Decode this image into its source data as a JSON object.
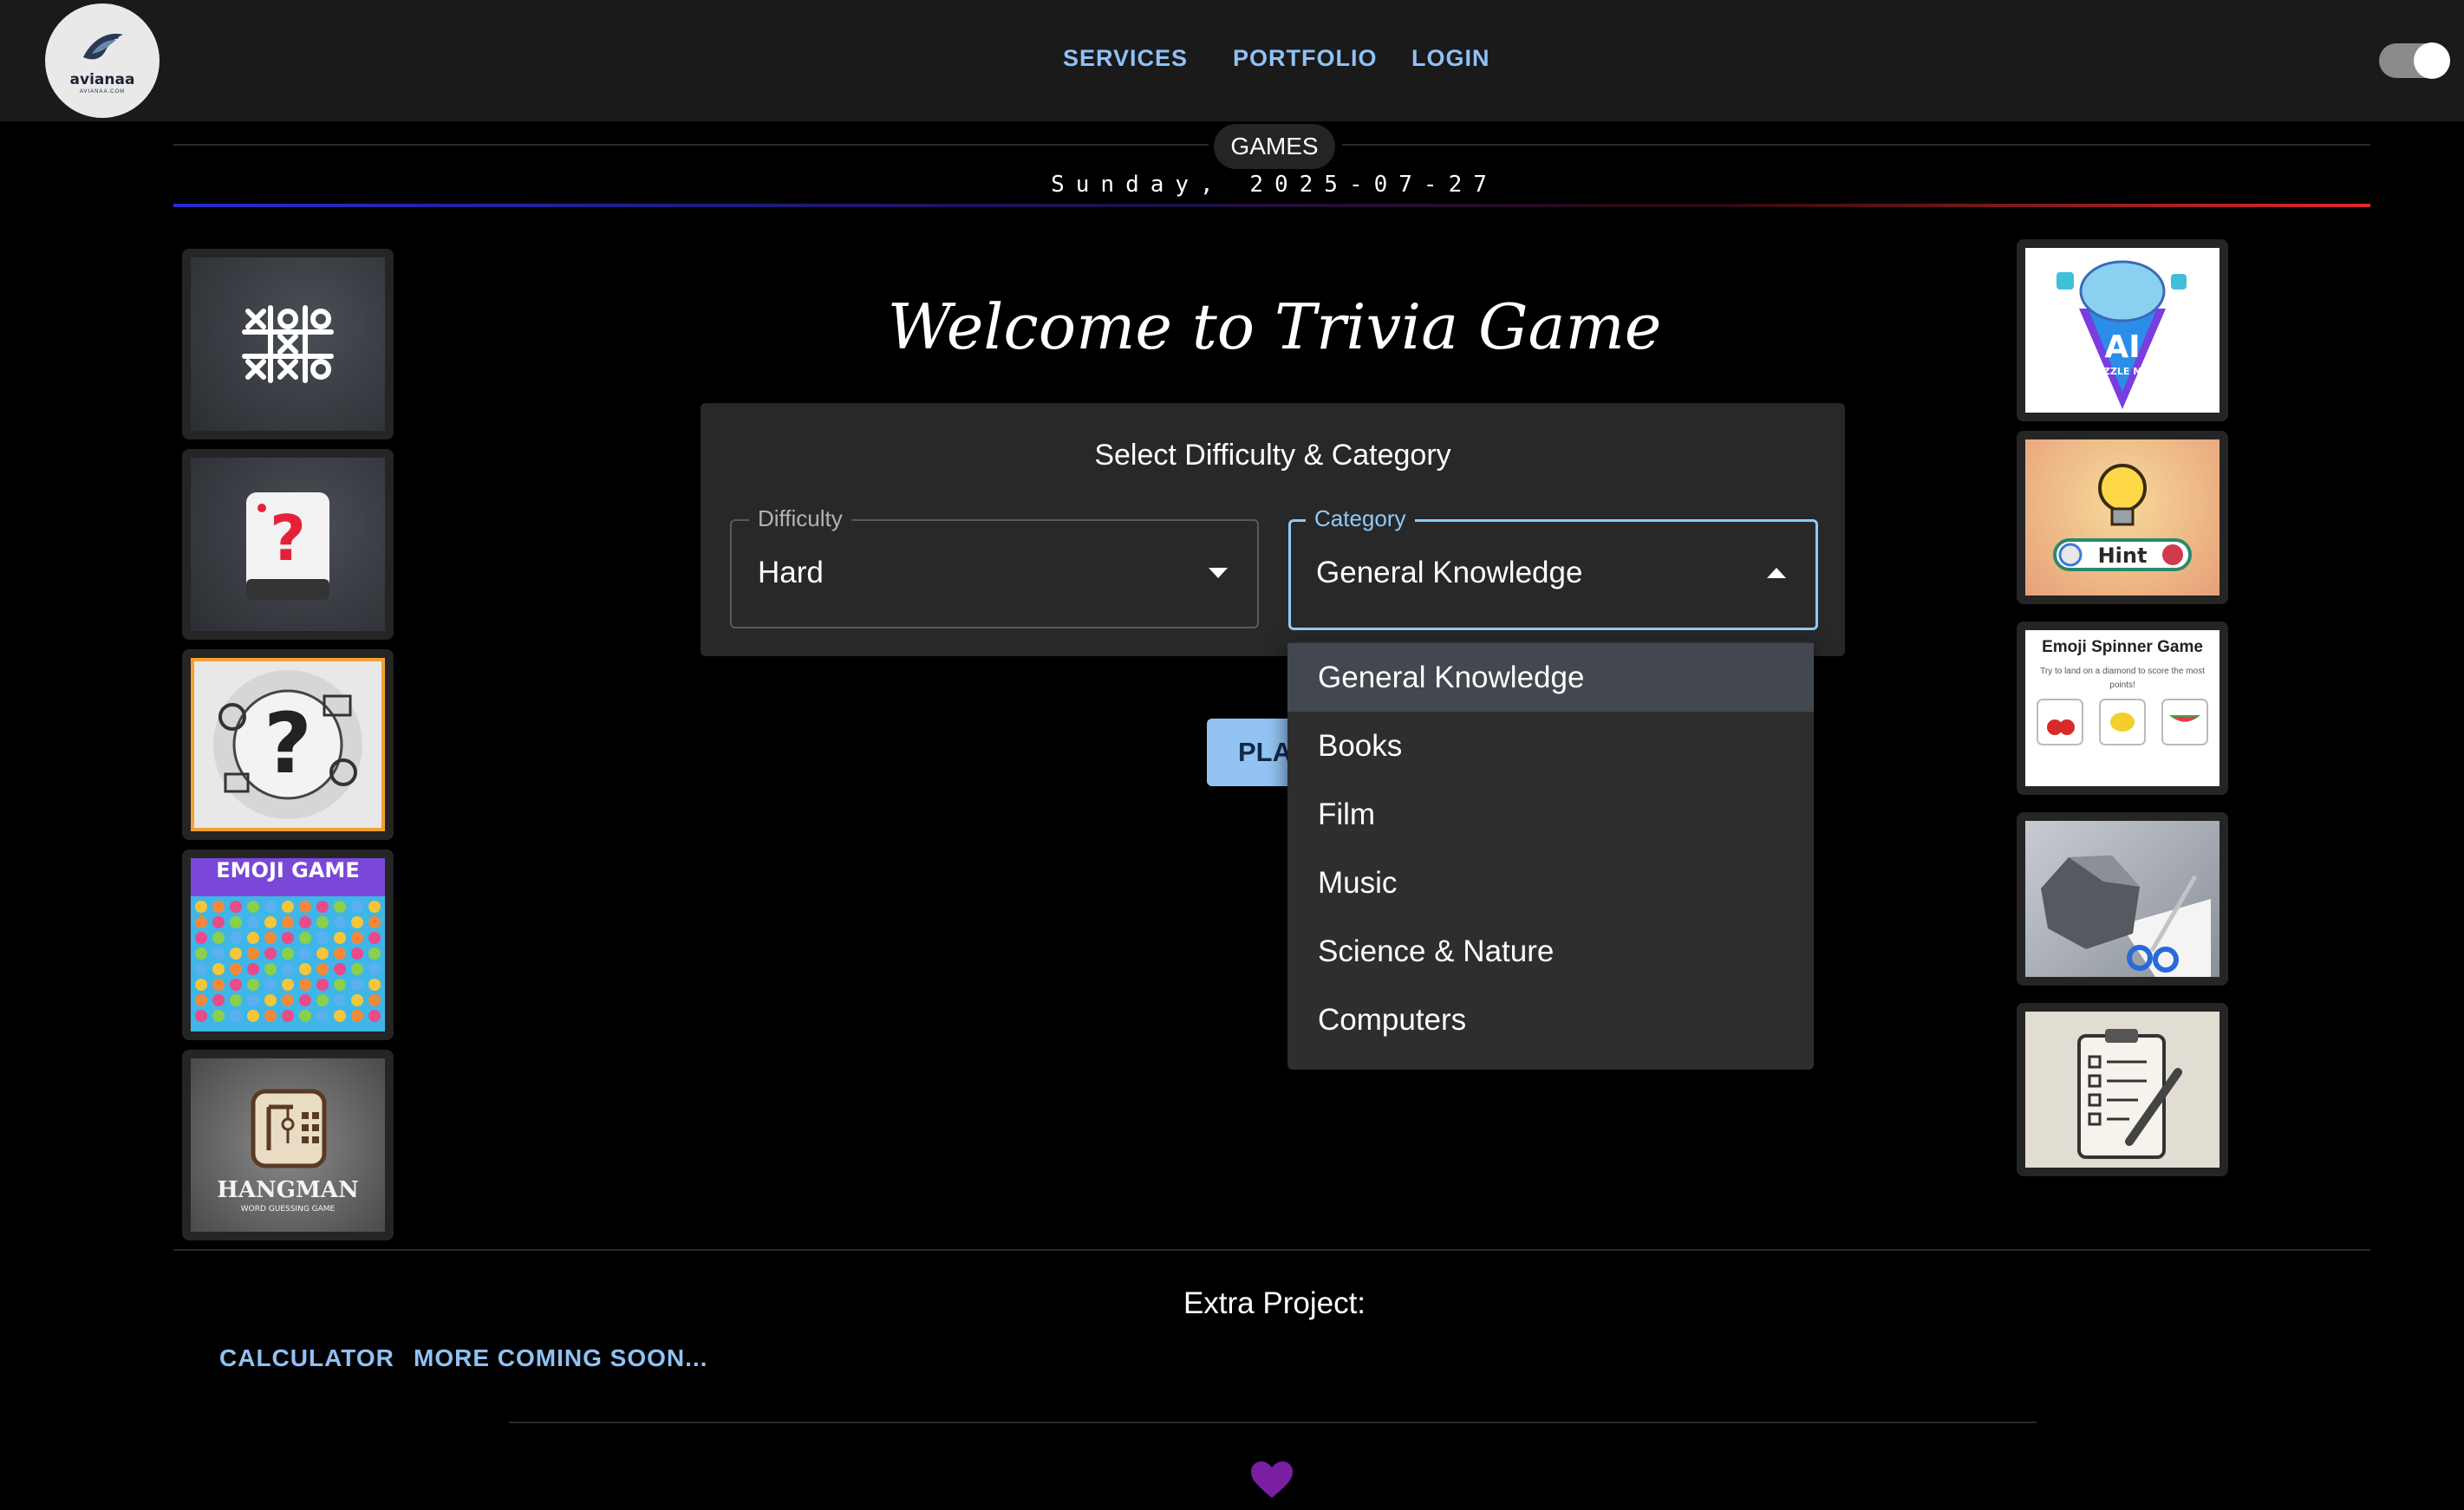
{
  "header": {
    "logo_text": "avianaa",
    "logo_subtext": "AVIANAA.COM",
    "nav": [
      "SERVICES",
      "PORTFOLIO",
      "LOGIN"
    ],
    "theme_toggle_on": true
  },
  "banner": {
    "section_label": "GAMES",
    "date": "Sunday, 2025-07-27"
  },
  "left_games": [
    {
      "name": "tic-tac-toe",
      "icon": "tic-tac-toe-icon"
    },
    {
      "name": "quiz",
      "icon": "question-card-icon"
    },
    {
      "name": "trivia",
      "icon": "question-mark-collage-icon"
    },
    {
      "name": "emoji-game",
      "icon": "emoji-grid-icon",
      "title": "EMOJI GAME"
    },
    {
      "name": "hangman",
      "icon": "hangman-icon",
      "title": "HANGMAN",
      "subtitle": "WORD GUESSING GAME"
    }
  ],
  "right_games": [
    {
      "name": "ai-puzzle-master",
      "icon": "brain-puzzle-icon",
      "title": "AI",
      "subtitle": "PUZZLE MASTER"
    },
    {
      "name": "hint-game",
      "icon": "lightbulb-icon",
      "button": "Hint"
    },
    {
      "name": "emoji-spinner",
      "icon": "fruit-icons",
      "title": "Emoji Spinner Game",
      "subtitle": "Try to land on a diamond to score the most points!"
    },
    {
      "name": "rock-paper-scissors",
      "icon": "rock-paper-scissors-icon"
    },
    {
      "name": "checklist",
      "icon": "checklist-icon"
    }
  ],
  "main": {
    "title": "Welcome to Trivia Game",
    "panel_title": "Select Difficulty & Category",
    "difficulty": {
      "label": "Difficulty",
      "value": "Hard"
    },
    "category": {
      "label": "Category",
      "value": "General Knowledge"
    },
    "play_button": "PLA",
    "category_options": [
      "General Knowledge",
      "Books",
      "Film",
      "Music",
      "Science & Nature",
      "Computers"
    ],
    "selected_option_index": 0
  },
  "footer": {
    "extra_title": "Extra Project:",
    "links": [
      "CALCULATOR",
      "MORE COMING SOON..."
    ]
  },
  "colors": {
    "accent": "#8fc2f5",
    "focus": "#90caf9",
    "heart": "#7b1fa2"
  }
}
